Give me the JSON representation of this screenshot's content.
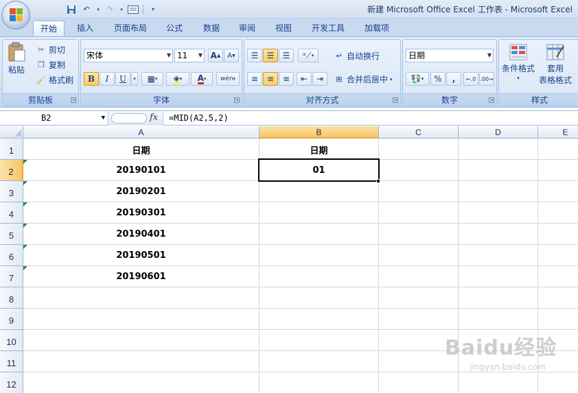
{
  "window": {
    "title": "新建 Microsoft Office Excel 工作表 - Microsoft Excel"
  },
  "quick_access": {
    "items": [
      "save-icon",
      "undo-icon",
      "redo-icon",
      "print-preview-icon",
      "customize-icon"
    ]
  },
  "ribbon_tabs": [
    "开始",
    "插入",
    "页面布局",
    "公式",
    "数据",
    "审阅",
    "视图",
    "开发工具",
    "加载项"
  ],
  "ribbon": {
    "clipboard": {
      "label": "剪贴板",
      "paste": "粘贴",
      "cut": "剪切",
      "copy": "复制",
      "format_painter": "格式刷"
    },
    "font": {
      "label": "字体",
      "font_name": "宋体",
      "font_size": "11",
      "bold": "B",
      "italic": "I",
      "underline": "U",
      "font_color_glyph": "A",
      "grow": "A",
      "shrink": "A",
      "phonetic": "wén"
    },
    "alignment": {
      "label": "对齐方式",
      "wrap_text": "自动换行",
      "merge_center": "合并后居中"
    },
    "number": {
      "label": "数字",
      "format": "日期",
      "percent": "%",
      "comma": ","
    },
    "styles": {
      "label": "样式",
      "conditional_format": "条件格式",
      "table_format_line1": "套用",
      "table_format_line2": "表格格式"
    }
  },
  "formula_bar": {
    "name_box": "B2",
    "fx": "fx",
    "formula": "=MID(A2,5,2)"
  },
  "columns": [
    "A",
    "B",
    "C",
    "D",
    "E"
  ],
  "rows": [
    "1",
    "2",
    "3",
    "4",
    "5",
    "6",
    "7",
    "8",
    "9",
    "10",
    "11",
    "12"
  ],
  "cells": {
    "A1": "日期",
    "B1": "日期",
    "A2": "20190101",
    "B2": "01",
    "A3": "20190201",
    "A4": "20190301",
    "A5": "20190401",
    "A6": "20190501",
    "A7": "20190601"
  },
  "selection": {
    "active_cell": "B2",
    "active_column": "B",
    "active_row": "2"
  },
  "watermark": {
    "main": "Baidu经验",
    "sub": "jingyan.baidu.com"
  },
  "colors": {
    "ribbon_bg": "#d5e3f5",
    "selected_header": "#f8c766",
    "gridline": "#d0d7e5",
    "error_triangle": "#2a8a3a"
  }
}
